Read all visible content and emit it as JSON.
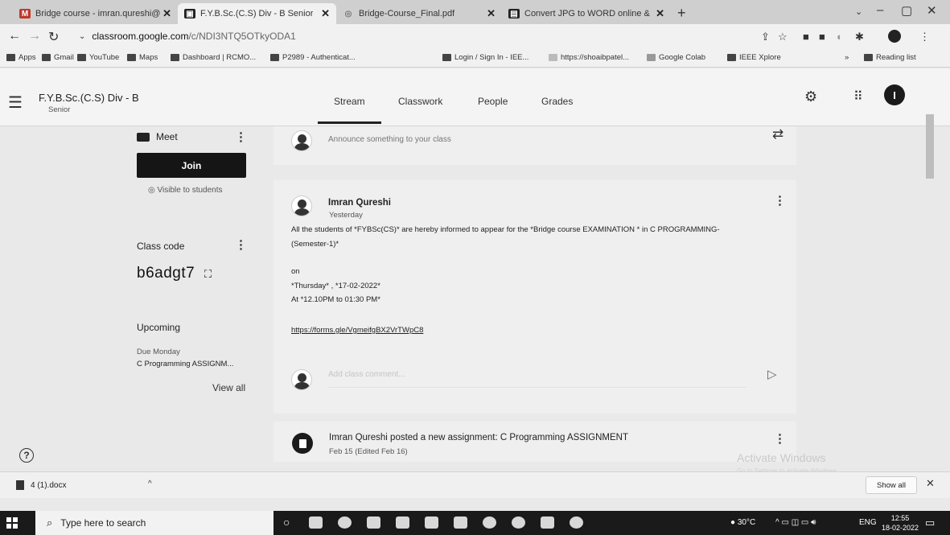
{
  "browser": {
    "tabs": [
      {
        "title": "Bridge course - imran.qureshi@",
        "icon": "gmail-icon",
        "active": false
      },
      {
        "title": "F.Y.B.Sc.(C.S) Div - B Senior",
        "icon": "classroom-icon",
        "active": true
      },
      {
        "title": "Bridge-Course_Final.pdf",
        "icon": "pdf-icon",
        "active": false
      },
      {
        "title": "Convert JPG to WORD online &",
        "icon": "converter-icon",
        "active": false
      }
    ],
    "url_host": "classroom.google.com",
    "url_path": "/c/NDI3NTQ5OTkyODA1",
    "bookmarks": [
      "Apps",
      "Gmail",
      "YouTube",
      "Maps",
      "Dashboard | RCMO...",
      "P2989 - Authenticat...",
      "Login / Sign In - IEE...",
      "https://shoaibpatel...",
      "Google Colab",
      "IEEE Xplore"
    ],
    "reading_list": "Reading list"
  },
  "header": {
    "class_name": "F.Y.B.Sc.(C.S) Div - B",
    "section": "Senior",
    "tabs": [
      "Stream",
      "Classwork",
      "People",
      "Grades"
    ],
    "avatar_letter": "I"
  },
  "sidebar": {
    "meet_title": "Meet",
    "join_label": "Join",
    "visible_text": "Visible to students",
    "class_code_label": "Class code",
    "class_code": "b6adgt7",
    "upcoming_label": "Upcoming",
    "due_text": "Due Monday",
    "upcoming_item": "C Programming ASSIGNM...",
    "view_all": "View all"
  },
  "stream": {
    "announce_placeholder": "Announce something to your class",
    "post": {
      "author": "Imran Qureshi",
      "time": "Yesterday",
      "line1": "All the students of *FYBSc(CS)* are hereby informed to appear for the *Bridge course EXAMINATION * in C PROGRAMMING-",
      "line2": "(Semester-1)*",
      "line3": "on",
      "line4": "*Thursday* , *17-02-2022*",
      "line5": "At *12.10PM to 01:30 PM*",
      "link": "https://forms.gle/VgmeifgBX2VrTWpC8",
      "comment_placeholder": "Add class comment..."
    },
    "assignment": {
      "title": "Imran Qureshi posted a new assignment: C Programming ASSIGNMENT",
      "date": "Feb 15 (Edited Feb 16)"
    },
    "watermark": "Activate Windows",
    "watermark_sub": "Go to Settings to activate Windows."
  },
  "downloads": {
    "file": "4 (1).docx",
    "show_all": "Show all"
  },
  "taskbar": {
    "search_placeholder": "Type here to search",
    "temperature": "30°C",
    "language": "ENG",
    "time": "12:55",
    "date": "18-02-2022"
  }
}
